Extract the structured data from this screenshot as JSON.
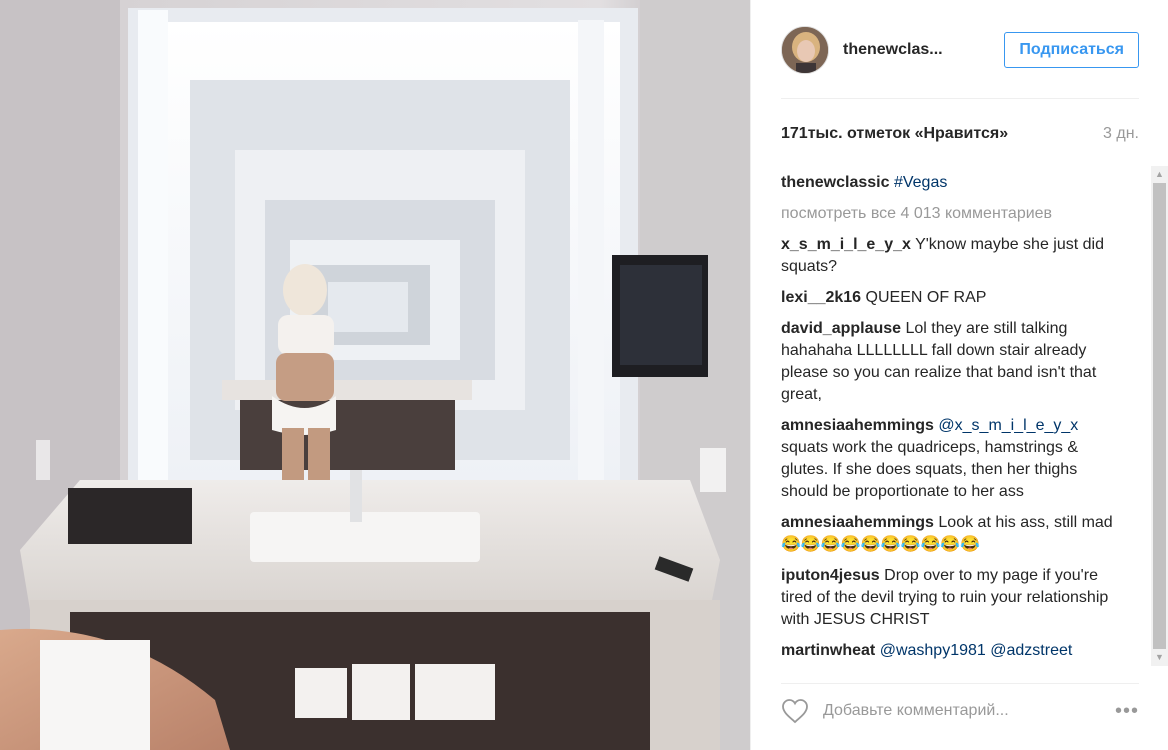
{
  "header": {
    "username": "thenewclas...",
    "follow_label": "Подписаться"
  },
  "stats": {
    "likes": "171тыс. отметок «Нравится»",
    "time": "3 дн."
  },
  "caption": {
    "user": "thenewclassic",
    "hashtag": "#Vegas"
  },
  "view_all": "посмотреть все 4 013 комментариев",
  "comments": [
    {
      "user": "x_s_m_i_l_e_y_x",
      "text": "Y'know maybe she just did squats?"
    },
    {
      "user": "lexi__2k16",
      "text": "QUEEN OF RAP"
    },
    {
      "user": "david_applause",
      "text": "Lol they are still talking hahahaha LLLLLLLL fall down stair already please so you can realize that band isn't that great,"
    },
    {
      "user": "amnesiaahemmings",
      "mention": "@x_s_m_i_l_e_y_x",
      "text": "squats work the quadriceps, hamstrings & glutes. If she does squats, then her thighs should be proportionate to her ass"
    },
    {
      "user": "amnesiaahemmings",
      "text": "Look at his ass, still mad😂😂😂😂😂😂😂😂😂😂"
    },
    {
      "user": "iputon4jesus",
      "text": "Drop over to my page if you're tired of the devil trying to ruin your relationship with JESUS CHRIST"
    },
    {
      "user": "martinwheat",
      "mention": "@washpy1981",
      "mention2": "@adzstreet"
    }
  ],
  "footer": {
    "placeholder": "Добавьте комментарий...",
    "more": "•••"
  },
  "icons": {
    "like": "heart-icon",
    "more": "more-icon"
  },
  "colors": {
    "accent": "#3897f0",
    "tag": "#003569",
    "muted": "#999999"
  }
}
